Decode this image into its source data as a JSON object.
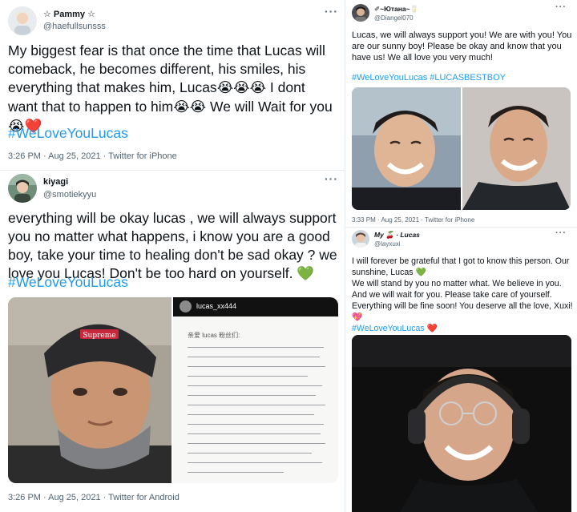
{
  "tweet1": {
    "display_name": "☆ Pammy ☆",
    "handle": "@haefullsunsss",
    "more": "···",
    "body_text": "My biggest fear is that once the time that Lucas will comeback, he becomes different, his smiles, his everything that makes him, Lucas",
    "cry3": "😭😭😭",
    "body_text2": " I dont want that to happen to him",
    "cry2": "😭😭",
    "body_text3": " We will Wait for you",
    "cry1": "😭",
    "heart": "❤️",
    "hashtag": "#WeLoveYouLucas",
    "meta": "3:26 PM · Aug 25, 2021 · Twitter for iPhone"
  },
  "tweet2": {
    "display_name": "kiyagi",
    "handle": "@smotiekyyu",
    "more": "···",
    "body_text": "everything will be okay lucas , we will always support you no matter what happens, i know you are a good boy, take your time to healing don't be sad okay ? we love you Lucas! Don't be too hard on yourself.",
    "heart": "💚",
    "hashtag": "#WeLoveYouLucas",
    "note_user": "lucas_xx444",
    "note_title": "亲爱 lucas 粉丝们:",
    "beanie_text": "Supreme",
    "meta": "3:26 PM · Aug 25, 2021 · Twitter for Android"
  },
  "tweet3": {
    "display_name": "✐~Ютана~",
    "name_emoji": "🥛",
    "handle": "@Diangel070",
    "more": "···",
    "body_text": "Lucas, we will always support you! We are with you! You are our sunny boy! Please be okay and know that you have us! We all love you very much!",
    "hashtags": "#WeLoveYouLucas #LUCASBESTBOY",
    "meta": "3:33 PM · Aug 25, 2021 · Twitter for iPhone"
  },
  "tweet4": {
    "display_name": "My",
    "name_emoji": "🍒",
    "display_name2": "· Lucas",
    "handle": "@layxuxi",
    "more": "···",
    "body_text1": "I will forever be grateful that I got to know this person. Our sunshine, Lucas",
    "green_heart": "💚",
    "body_text2": "We will stand by you no matter what. We believe in you. And we will wait for you. Please take care of yourself. Everything will be fine soon! You deserve all the love, Xuxi!",
    "sparkle_heart": "💖",
    "hashtag": "#WeLoveYouLucas",
    "red_heart": "❤️"
  },
  "colors": {
    "link": "#1d9bf0",
    "meta": "#536471",
    "text": "#0f1419",
    "divider": "#e6ecf0"
  }
}
